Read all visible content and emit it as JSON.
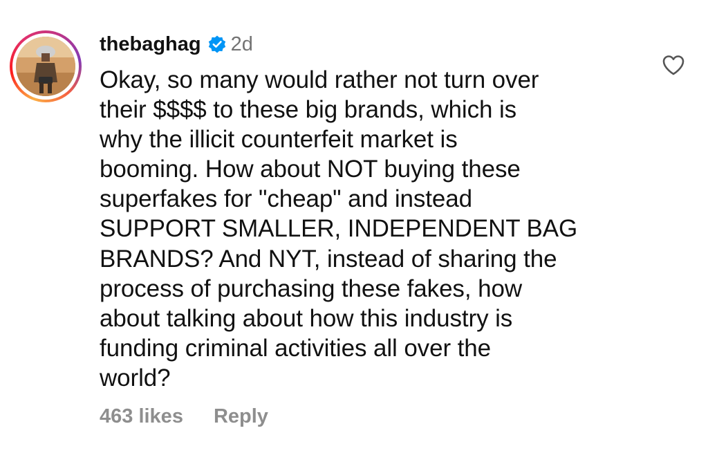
{
  "comment": {
    "username": "thebaghag",
    "verified": true,
    "timestamp": "2d",
    "text": "Okay, so many would rather not turn over\ntheir $$$$ to these big brands, which is\nwhy the illicit counterfeit market is\nbooming. How about NOT buying these\nsuperfakes for \"cheap\" and instead\nSUPPORT SMALLER, INDEPENDENT BAG\nBRANDS? And NYT, instead of sharing the\nprocess of purchasing these fakes, how\nabout talking about how this industry is\nfunding criminal activities all over the\nworld?",
    "likes_label": "463 likes",
    "reply_label": "Reply",
    "icons": {
      "verified": "verified-badge-icon",
      "like": "heart-outline-icon"
    }
  },
  "colors": {
    "text": "#111111",
    "muted": "#8e8e8e",
    "timestamp": "#737373",
    "verified_blue": "#0095f6"
  }
}
